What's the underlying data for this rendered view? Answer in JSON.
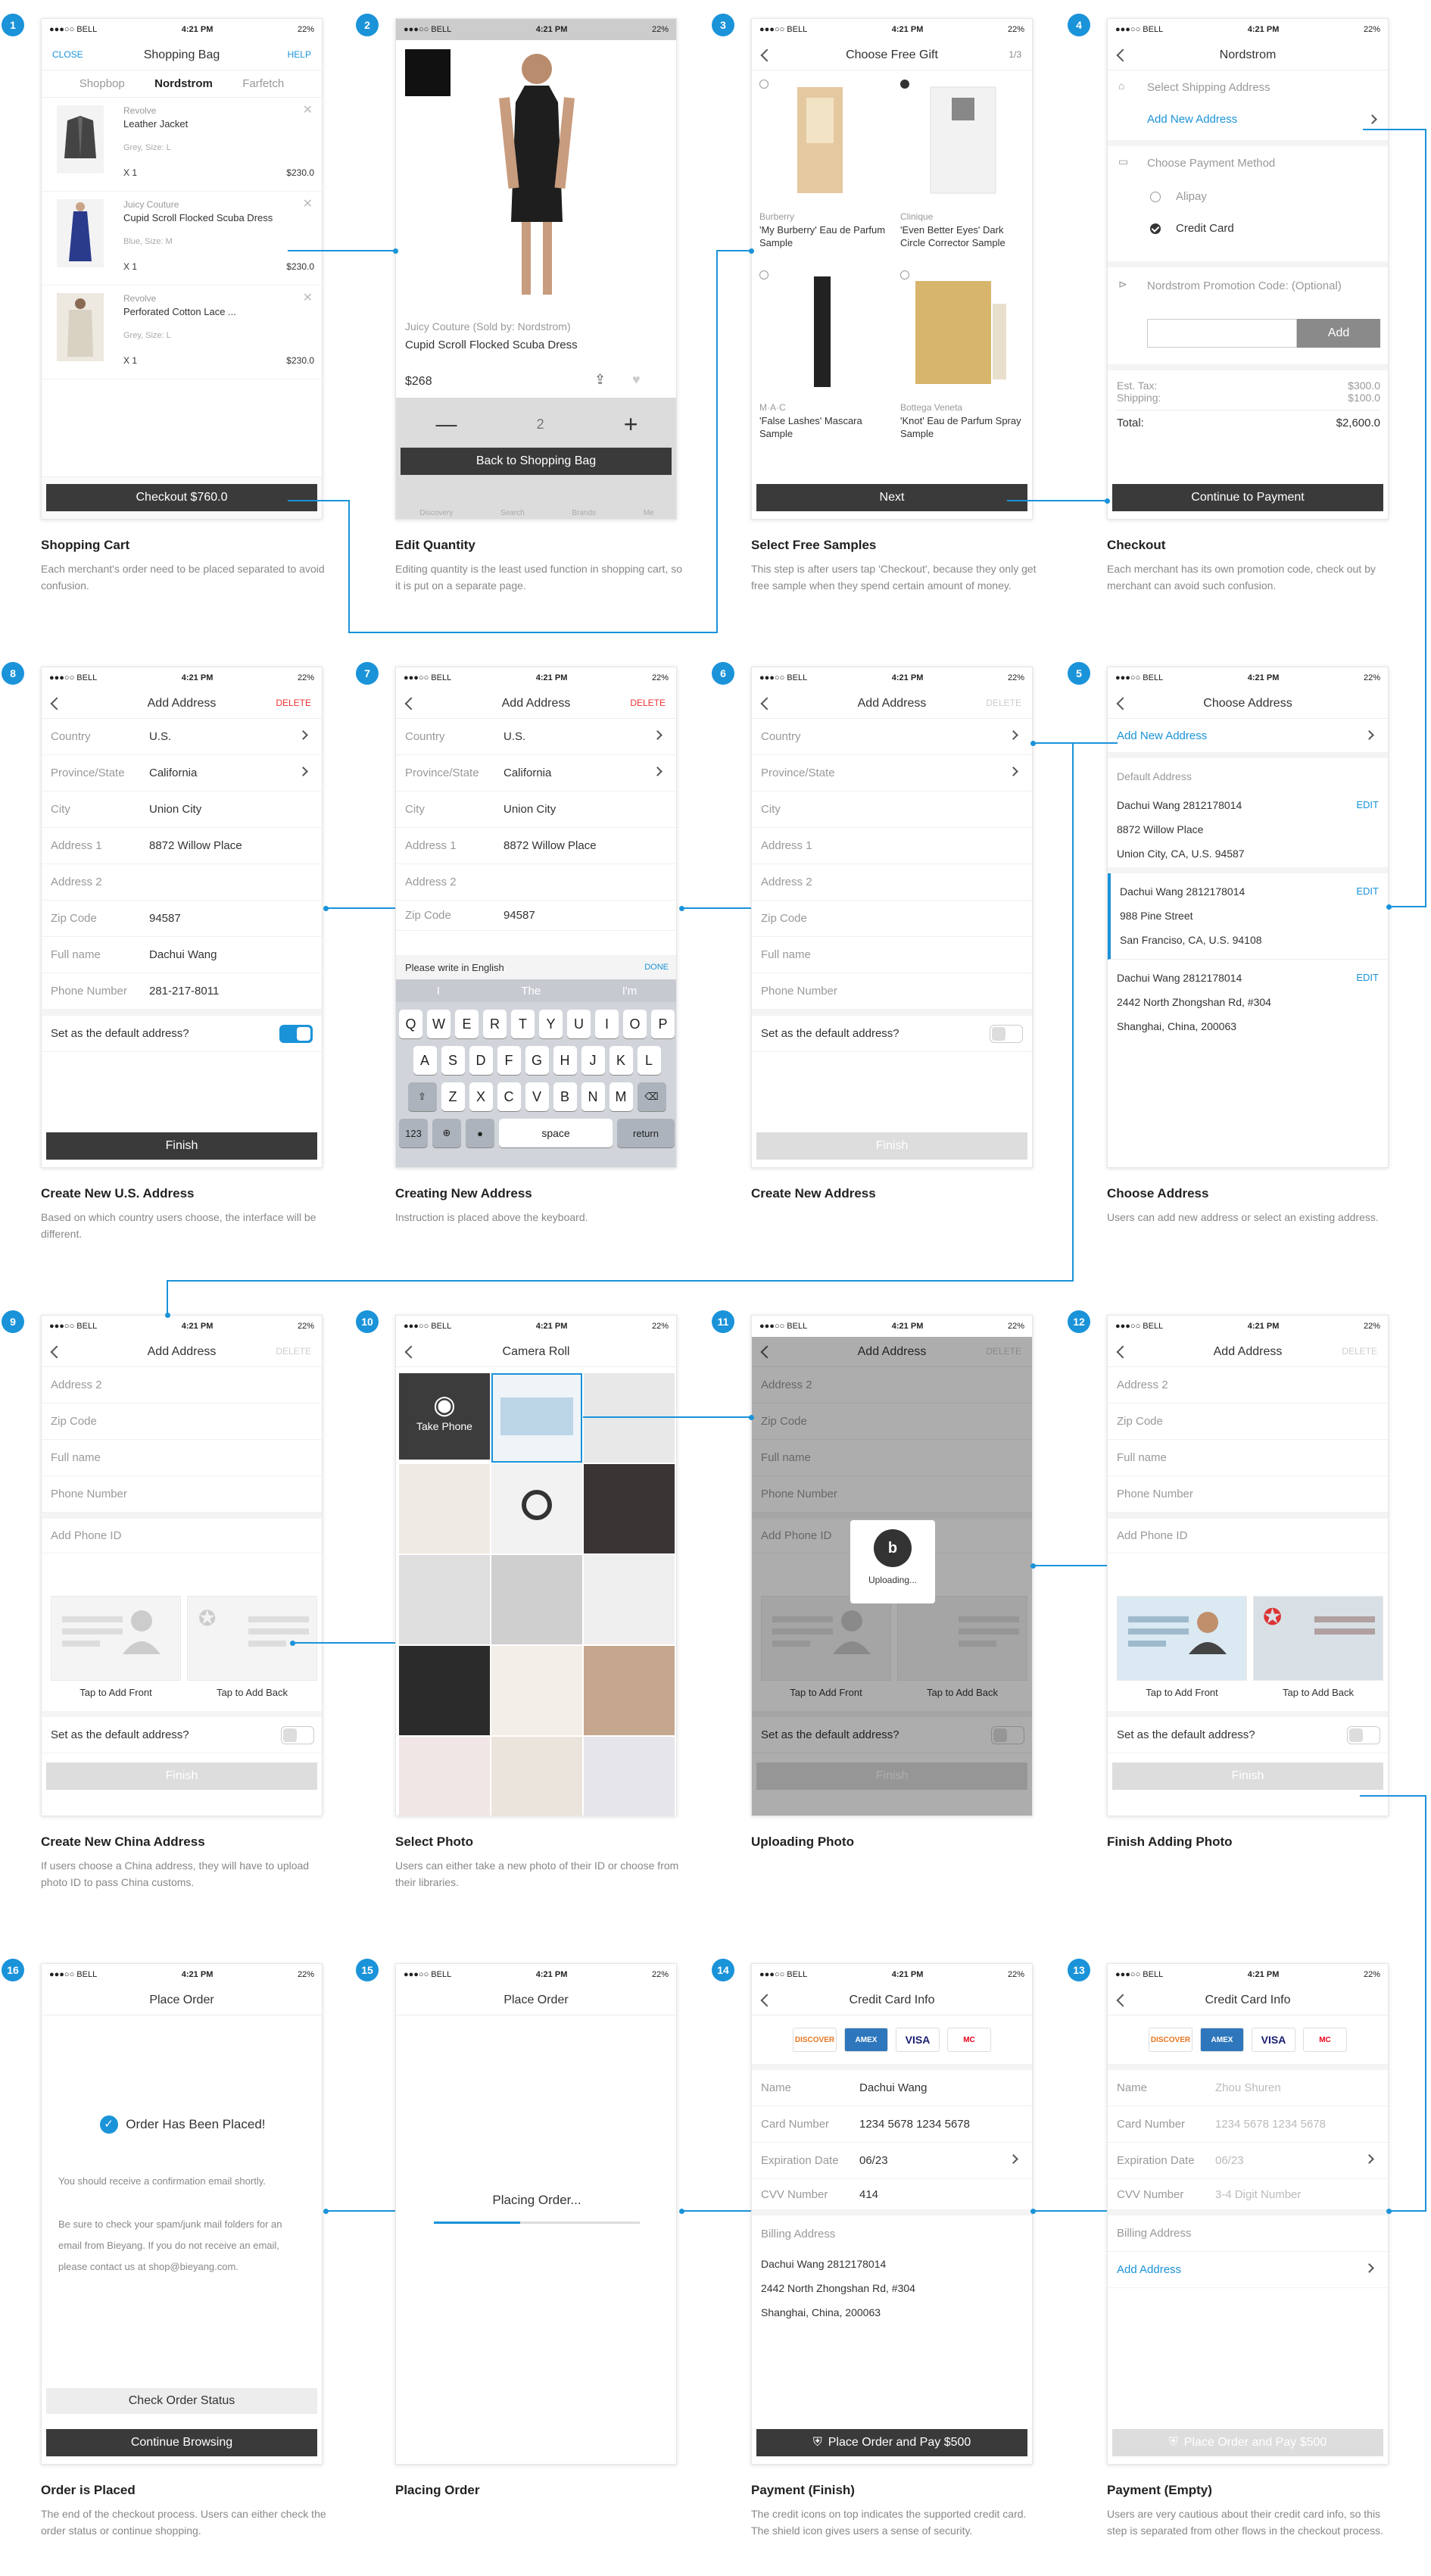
{
  "status": {
    "carrier": "●●●○○ BELL",
    "time": "4:21 PM",
    "battery": "22%"
  },
  "s1": {
    "num": "1",
    "close": "CLOSE",
    "title": "Shopping Bag",
    "help": "HELP",
    "tabs": [
      "Shopbop",
      "Nordstrom",
      "Farfetch"
    ],
    "items": [
      {
        "brand": "Revolve",
        "name": "Leather Jacket",
        "sub": "Grey, Size: L",
        "qty": "X 1",
        "price": "$230.0"
      },
      {
        "brand": "Juicy Couture",
        "name": "Cupid Scroll Flocked Scuba Dress",
        "sub": "Blue, Size: M",
        "qty": "X 1",
        "price": "$230.0"
      },
      {
        "brand": "Revolve",
        "name": "Perforated Cotton Lace ...",
        "sub": "Grey, Size: L",
        "qty": "X 1",
        "price": "$230.0"
      }
    ],
    "checkout": "Checkout  $760.0",
    "cap_title": "Shopping Cart",
    "cap_desc": "Each merchant's order need to be placed separated to avoid confusion."
  },
  "s2": {
    "num": "2",
    "brand": "Juicy Couture (Sold by: Nordstrom)",
    "name": "Cupid Scroll Flocked Scuba Dress",
    "price": "$268",
    "qty": "2",
    "back": "Back to Shopping Bag",
    "tabs": [
      "Discovery",
      "Search",
      "Brands",
      "Me"
    ],
    "cap_title": "Edit Quantity",
    "cap_desc": "Editing quantity is the least used function in shopping cart, so it is put on a separate page."
  },
  "s3": {
    "num": "3",
    "title": "Choose Free Gift",
    "page": "1/3",
    "gifts": [
      {
        "brand": "Burberry",
        "name": "'My Burberry' Eau de Parfum Sample"
      },
      {
        "brand": "Clinique",
        "name": "'Even Better Eyes' Dark Circle Corrector Sample"
      },
      {
        "brand": "M·A·C",
        "name": "'False Lashes' Mascara Sample"
      },
      {
        "brand": "Bottega Veneta",
        "name": "'Knot' Eau de Parfum Spray Sample"
      }
    ],
    "next": "Next",
    "cap_title": "Select Free Samples",
    "cap_desc": "This step is after users tap 'Checkout', because they only get free sample when they spend certain amount of money."
  },
  "s4": {
    "num": "4",
    "title": "Nordstrom",
    "ship": "Select Shipping Address",
    "add": "Add New Address",
    "pay": "Choose Payment Method",
    "alipay": "Alipay",
    "credit": "Credit Card",
    "promo": "Nordstrom Promotion Code: (Optional)",
    "add_btn": "Add",
    "tax_l": "Est. Tax:",
    "tax_v": "$300.0",
    "ship_l": "Shipping:",
    "ship_v": "$100.0",
    "total_l": "Total:",
    "total_v": "$2,600.0",
    "cont": "Continue to Payment",
    "cap_title": "Checkout",
    "cap_desc": "Each merchant has its own promotion code, check out by merchant can avoid such confusion."
  },
  "s5": {
    "num": "5",
    "title": "Choose Address",
    "add": "Add New Address",
    "default": "Default Address",
    "edit": "EDIT",
    "addrs": [
      {
        "name": "Dachui Wang   2812178014",
        "l1": "8872 Willow Place",
        "l2": "Union City, CA, U.S. 94587"
      },
      {
        "name": "Dachui Wang   2812178014",
        "l1": "988 Pine Street",
        "l2": "San Franciso, CA, U.S. 94108"
      },
      {
        "name": "Dachui Wang   2812178014",
        "l1": "2442 North Zhongshan Rd, #304",
        "l2": "Shanghai, China, 200063"
      }
    ],
    "cap_title": "Choose Address",
    "cap_desc": "Users can add new address or select an existing address."
  },
  "addr_labels": {
    "country": "Country",
    "province": "Province/State",
    "city": "City",
    "a1": "Address 1",
    "a2": "Address 2",
    "zip": "Zip Code",
    "full": "Full name",
    "phone": "Phone Number",
    "default": "Set as the default address?",
    "finish": "Finish",
    "title": "Add Address",
    "delete": "DELETE",
    "phoneid": "Add Phone ID",
    "front": "Tap to Add Front",
    "back": "Tap to Add Back"
  },
  "addr_values": {
    "country": "U.S.",
    "province": "California",
    "city": "Union City",
    "a1": "8872 Willow Place",
    "zip": "94587",
    "full": "Dachui Wang",
    "phone": "281-217-8011"
  },
  "s6": {
    "num": "6",
    "cap_title": "Create New Address",
    "cap_desc": ""
  },
  "s7": {
    "num": "7",
    "hint": "Please write in English",
    "done": "DONE",
    "sugg": [
      "I",
      "The",
      "I'm"
    ],
    "row1": [
      "Q",
      "W",
      "E",
      "R",
      "T",
      "Y",
      "U",
      "I",
      "O",
      "P"
    ],
    "row2": [
      "A",
      "S",
      "D",
      "F",
      "G",
      "H",
      "J",
      "K",
      "L"
    ],
    "row3": [
      "Z",
      "X",
      "C",
      "V",
      "B",
      "N",
      "M"
    ],
    "k123": "123",
    "space": "space",
    "ret": "return",
    "cap_title": "Creating New Address",
    "cap_desc": "Instruction is placed above the keyboard."
  },
  "s8": {
    "num": "8",
    "cap_title": "Create New U.S. Address",
    "cap_desc": "Based on which country users choose, the interface will be different."
  },
  "s9": {
    "num": "9",
    "cap_title": "Create New China Address",
    "cap_desc": "If users choose a China address, they will have to upload photo ID to pass China customs."
  },
  "s10": {
    "num": "10",
    "title": "Camera Roll",
    "take": "Take Phone",
    "cap_title": "Select Photo",
    "cap_desc": "Users can either take a new photo of their ID or choose from their libraries."
  },
  "s11": {
    "num": "11",
    "uploading": "Uploading...",
    "cap_title": "Uploading Photo",
    "cap_desc": ""
  },
  "s12": {
    "num": "12",
    "cap_title": "Finish Adding Photo",
    "cap_desc": ""
  },
  "cc": {
    "title": "Credit Card Info",
    "name": "Name",
    "number": "Card Number",
    "exp": "Expiration Date",
    "cvv": "CVV Number",
    "billing": "Billing Address",
    "logos": [
      "DISCOVER",
      "AMEX",
      "VISA",
      "MC"
    ]
  },
  "s13": {
    "num": "13",
    "name_ph": "Zhou Shuren",
    "num_ph": "1234 5678 1234 5678",
    "exp_ph": "06/23",
    "cvv_ph": "3-4 Digit Number",
    "add": "Add Address",
    "place": "Place Order and Pay $500",
    "cap_title": "Payment (Empty)",
    "cap_desc": "Users are very cautious about their credit card info, so this step is separated from other flows in the checkout process."
  },
  "s14": {
    "num": "14",
    "name_v": "Dachui Wang",
    "num_v": "1234 5678 1234 5678",
    "exp_v": "06/23",
    "cvv_v": "414",
    "b_name": "Dachui Wang   2812178014",
    "b_l1": "2442 North Zhongshan Rd, #304",
    "b_l2": "Shanghai, China, 200063",
    "place": "Place Order and Pay $500",
    "cap_title": "Payment (Finish)",
    "cap_desc": "The credit icons on top indicates the supported credit card. The shield icon gives users a sense of security."
  },
  "s15": {
    "num": "15",
    "title": "Place Order",
    "placing": "Placing Order...",
    "progress": 0.42,
    "cap_title": "Placing Order",
    "cap_desc": ""
  },
  "s16": {
    "num": "16",
    "title": "Place Order",
    "placed": "Order Has Been Placed!",
    "p1": "You should receive a confirmation email shortly.",
    "p2": "Be sure to check your spam/junk mail folders for an email from Bieyang. If you do not receive an email, please contact us at shop@bieyang.com.",
    "check": "Check Order Status",
    "cont": "Continue Browsing",
    "cap_title": "Order is Placed",
    "cap_desc": "The end of the checkout process. Users can either check the order status or continue shopping."
  },
  "colors": {
    "accent": "#1a93d9",
    "dark_button": "#3a3a3a",
    "delete": "#e33333"
  }
}
